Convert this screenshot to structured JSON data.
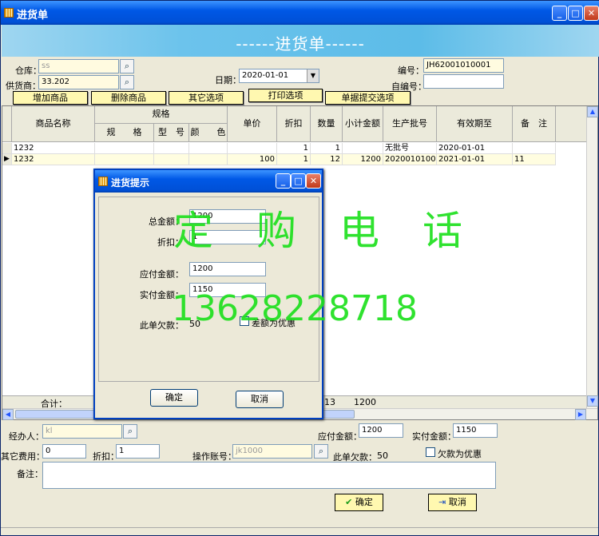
{
  "window": {
    "title": "进货单"
  },
  "banner": {
    "title": "------进货单------"
  },
  "form": {
    "warehouse_label": "仓库：",
    "warehouse_value": "ss",
    "supplier_label": "供货商：",
    "supplier_value": "33.202",
    "date_label": "日期：",
    "date_value": "2020-01-01",
    "number_label": "编号：",
    "number_value": "JH62001010001",
    "self_number_label": "自编号：",
    "self_number_value": ""
  },
  "toolbar": {
    "add": "增加商品",
    "delete": "删除商品",
    "other": "其它选项",
    "print": "打印选项",
    "submit": "单据提交选项"
  },
  "table": {
    "headers": {
      "name": "商品名称",
      "spec_group": "规格",
      "spec": "规　　格",
      "model": "型　号",
      "color": "颜　　色",
      "price": "单价",
      "discount": "折扣",
      "qty": "数量",
      "subtotal": "小计金额",
      "batch": "生产批号",
      "expiry": "有效期至",
      "note": "备　注"
    },
    "rows": [
      {
        "name": "1232",
        "price": "",
        "discount": "1",
        "qty": "1",
        "subtotal": "",
        "batch": "无批号",
        "expiry": "2020-01-01",
        "note": ""
      },
      {
        "name": "1232",
        "price": "100",
        "discount": "1",
        "qty": "12",
        "subtotal": "1200",
        "batch": "2020010100",
        "expiry": "2021-01-01",
        "note": "11"
      }
    ],
    "total_label": "合计：",
    "total_qty": "13",
    "total_amount": "1200"
  },
  "dialog": {
    "title": "进货提示",
    "total_label": "总金额：",
    "total_value": "1200",
    "discount_label": "折扣：",
    "discount_value": "1",
    "payable_label": "应付金额：",
    "payable_value": "1200",
    "paid_label": "实付金额：",
    "paid_value": "1150",
    "debt_label": "此单欠款：",
    "debt_value": "50",
    "diff_label": "差额为优惠",
    "ok": "确定",
    "cancel": "取消"
  },
  "watermark": {
    "line1": "定　购　电　话",
    "line2": "13628228718"
  },
  "bottom": {
    "handler_label": "经办人：",
    "handler_value": "kl",
    "payable_label": "应付金额：",
    "payable_value": "1200",
    "paid_label": "实付金额：",
    "paid_value": "1150",
    "other_fee_label": "其它费用：",
    "other_fee_value": "0",
    "discount_label": "折扣：",
    "discount_value": "1",
    "operator_label": "操作账号：",
    "operator_value": "jk1000",
    "debt_label": "此单欠款：",
    "debt_value": "50",
    "debt_checkbox": "欠款为优惠",
    "remark_label": "备注：",
    "ok": "确定",
    "cancel": "取消"
  },
  "colors": {
    "title_blue": "#0058e6",
    "banner": "#6cc3ec",
    "button_yellow": "#fff8b0",
    "watermark": "#1ee01e"
  }
}
